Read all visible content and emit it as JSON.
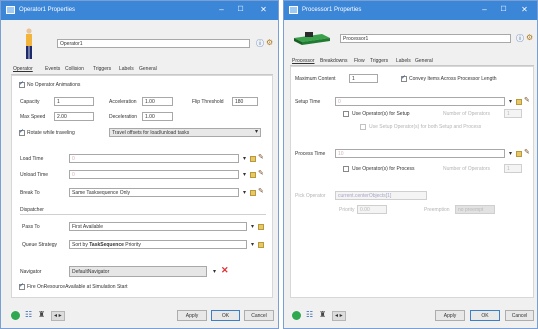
{
  "colors": {
    "titlebar": "#3c86d8",
    "accent": "#1f6fc5",
    "close_red": "#e03030"
  },
  "left": {
    "title": "Operator1 Properties",
    "name_value": "Operator1",
    "tabs": [
      "Operator",
      "Events",
      "Collision",
      "Triggers",
      "Labels",
      "General"
    ],
    "no_anim_label": "No Operator Animations",
    "capacity_label": "Capacity",
    "capacity_value": "1",
    "acceleration_label": "Acceleration",
    "acceleration_value": "1.00",
    "flip_label": "Flip Threshold",
    "flip_value": "180",
    "max_speed_label": "Max Speed",
    "max_speed_value": "2.00",
    "deceleration_label": "Deceleration",
    "deceleration_value": "1.00",
    "rotate_label": "Rotate while traveling",
    "travel_offsets_value": "Travel offsets for load/unload tasks",
    "load_time_label": "Load Time",
    "load_time_value": "0",
    "unload_time_label": "Unload Time",
    "unload_time_value": "0",
    "break_to_label": "Break To",
    "break_to_value": "Same Tasksequence Only",
    "dispatcher_label": "Dispatcher",
    "pass_to_label": "Pass To",
    "pass_to_value": "First Available",
    "queue_label": "Queue Strategy",
    "queue_value_prefix": "Sort by ",
    "queue_value_bold": "TaskSequence",
    "queue_value_suffix": " Priority",
    "navigator_label": "Navigator",
    "navigator_value": "DefaultNavigator",
    "reset_label": "Fire OnResourceAvailable at Simulation Start",
    "apply": "Apply",
    "ok": "OK",
    "cancel": "Cancel"
  },
  "right": {
    "title": "Processor1 Properties",
    "name_value": "Processor1",
    "tabs": [
      "Processor",
      "Breakdowns",
      "Flow",
      "Triggers",
      "Labels",
      "General"
    ],
    "max_content_label": "Maximum Content",
    "max_content_value": "1",
    "convey_label": "Convey Items Across Processor Length",
    "setup_time_label": "Setup Time",
    "setup_time_value": "0",
    "use_op_setup_label": "Use Operator(s) for Setup",
    "num_ops_label": "Number of Operators",
    "num_ops_setup_value": "1",
    "use_setup_both_label": "Use Setup Operator(s) for both Setup and Process",
    "process_time_label": "Process Time",
    "process_time_value": "10",
    "use_op_process_label": "Use Operator(s) for Process",
    "num_ops_process_value": "1",
    "pick_op_label": "Pick Operator",
    "pick_op_value": "current.centerObjects[1]",
    "priority_label": "Priority",
    "priority_value": "0.00",
    "preemption_label": "Preemption",
    "preemption_value": "no preempt",
    "apply": "Apply",
    "ok": "OK",
    "cancel": "Cancel"
  }
}
